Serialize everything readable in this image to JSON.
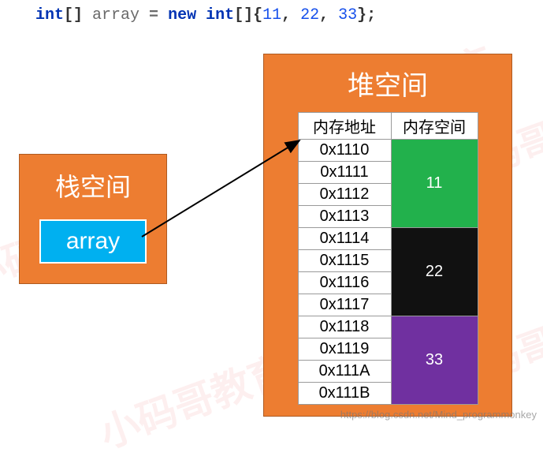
{
  "code": {
    "kw1": "int",
    "br1": "[] ",
    "name": "array",
    "eq": " = ",
    "kw2": "new int",
    "br2": "[]{",
    "n1": "11",
    "c1": ", ",
    "n2": "22",
    "c2": ", ",
    "n3": "33",
    "end": "};"
  },
  "stack": {
    "title": "栈空间",
    "var": "array"
  },
  "heap": {
    "title": "堆空间",
    "headers": {
      "addr": "内存地址",
      "space": "内存空间"
    },
    "rows": [
      {
        "addr": "0x1110"
      },
      {
        "addr": "0x1111"
      },
      {
        "addr": "0x1112"
      },
      {
        "addr": "0x1113"
      },
      {
        "addr": "0x1114"
      },
      {
        "addr": "0x1115"
      },
      {
        "addr": "0x1116"
      },
      {
        "addr": "0x1117"
      },
      {
        "addr": "0x1118"
      },
      {
        "addr": "0x1119"
      },
      {
        "addr": "0x111A"
      },
      {
        "addr": "0x111B"
      }
    ],
    "values": [
      {
        "val": "11",
        "cls": "val-green"
      },
      {
        "val": "22",
        "cls": "val-black"
      },
      {
        "val": "33",
        "cls": "val-purple"
      }
    ]
  },
  "watermark": "小码哥教育",
  "attribution": "https://blog.csdn.net/Mind_programmonkey"
}
